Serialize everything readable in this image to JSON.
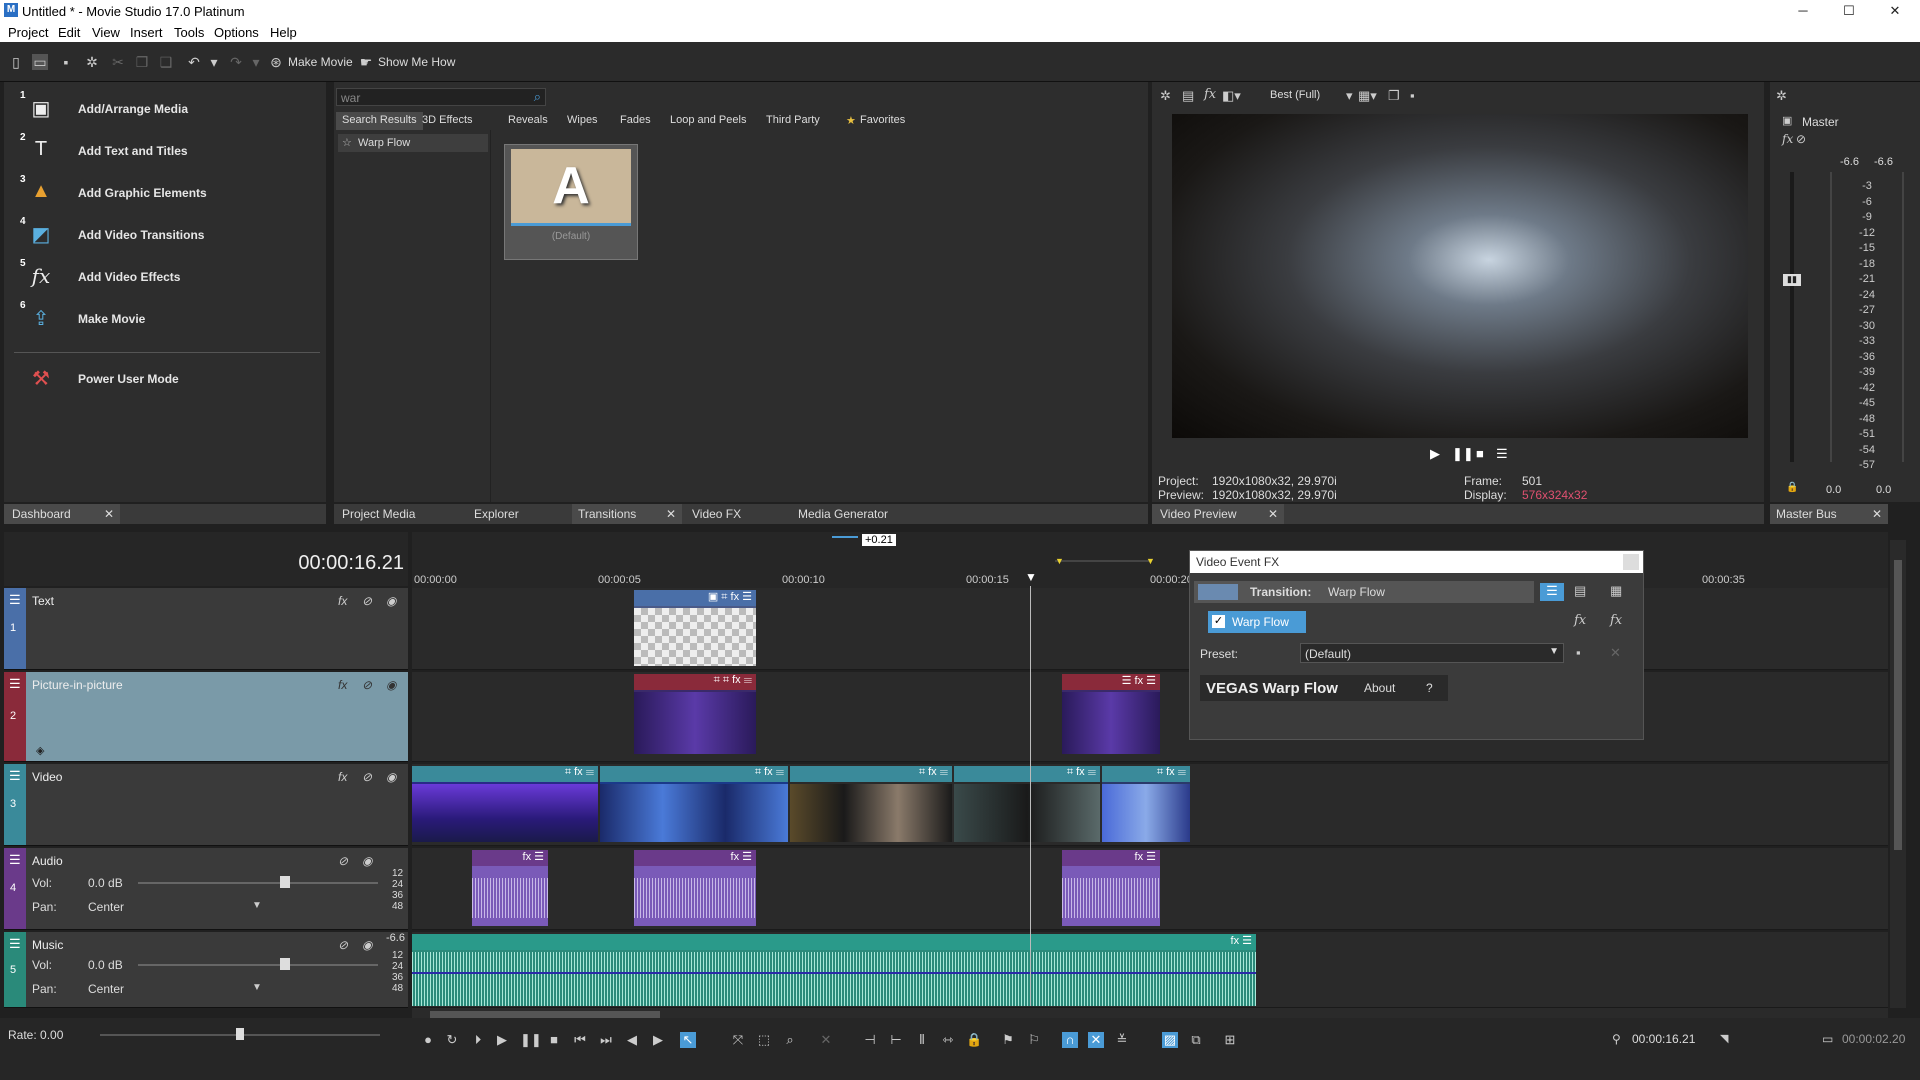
{
  "window": {
    "title": "Untitled * - Movie Studio 17.0 Platinum",
    "app_icon": "M",
    "minimize": "─",
    "maximize": "☐",
    "close": "✕"
  },
  "menu": [
    "Project",
    "Edit",
    "View",
    "Insert",
    "Tools",
    "Options",
    "Help"
  ],
  "toolbar": {
    "make_movie": "Make Movie",
    "show_me_how": "Show Me How"
  },
  "dashboard": {
    "tab": "Dashboard",
    "items": [
      {
        "num": "1",
        "label": "Add/Arrange Media",
        "icon": "media-icon"
      },
      {
        "num": "2",
        "label": "Add Text and Titles",
        "icon": "text-icon"
      },
      {
        "num": "3",
        "label": "Add Graphic Elements",
        "icon": "shapes-icon"
      },
      {
        "num": "4",
        "label": "Add Video Transitions",
        "icon": "transition-icon"
      },
      {
        "num": "5",
        "label": "Add Video Effects",
        "icon": "fx-icon"
      },
      {
        "num": "6",
        "label": "Make Movie",
        "icon": "export-icon"
      }
    ],
    "power_user": "Power User Mode"
  },
  "transitions": {
    "search_value": "war",
    "tabs": [
      "Search Results",
      "3D Effects",
      "Reveals",
      "Wipes",
      "Fades",
      "Loop and Peels",
      "Third Party",
      "Favorites"
    ],
    "list_item": "Warp Flow",
    "thumb_letter": "A",
    "thumb_label": "(Default)"
  },
  "bottom_tabs": [
    "Project Media",
    "Explorer",
    "Transitions",
    "Video FX",
    "Media Generator"
  ],
  "preview": {
    "quality": "Best (Full)",
    "project_label": "Project:",
    "project": "1920x1080x32, 29.970i",
    "preview_label": "Preview:",
    "preview": "1920x1080x32, 29.970i",
    "frame_label": "Frame:",
    "frame": "501",
    "display_label": "Display:",
    "display": "576x324x32",
    "tab": "Video Preview"
  },
  "master": {
    "title": "Master",
    "left_db": "-6.6",
    "right_db": "-6.6",
    "scale": [
      "3",
      "6",
      "9",
      "12",
      "15",
      "18",
      "21",
      "24",
      "27",
      "30",
      "33",
      "36",
      "39",
      "42",
      "45",
      "48",
      "51",
      "54",
      "57"
    ],
    "bottom_left": "0.0",
    "bottom_right": "0.0",
    "tab": "Master Bus"
  },
  "timeline": {
    "timecode": "00:00:16.21",
    "offset": "+0.21",
    "ruler": [
      "00:00:00",
      "00:00:05",
      "00:00:10",
      "00:00:15",
      "00:00:20",
      "00:00:35"
    ],
    "tracks": [
      {
        "num": "1",
        "name": "Text",
        "color": "#4a6fa8"
      },
      {
        "num": "2",
        "name": "Picture-in-picture",
        "color": "#8a2a3a"
      },
      {
        "num": "3",
        "name": "Video",
        "color": "#3a8a9a"
      },
      {
        "num": "4",
        "name": "Audio",
        "color": "#6a3a8a",
        "vol_label": "Vol:",
        "vol": "0.0 dB",
        "pan_label": "Pan:",
        "pan": "Center"
      },
      {
        "num": "5",
        "name": "Music",
        "color": "#2a8a7a",
        "vol_label": "Vol:",
        "vol": "0.0 dB",
        "pan_label": "Pan:",
        "pan": "Center"
      }
    ],
    "meter_scale": [
      "12",
      "24",
      "36",
      "48"
    ],
    "music_db": "-6.6",
    "rate": "Rate: 0.00"
  },
  "vfx": {
    "title": "Video Event FX",
    "transition_label": "Transition:",
    "transition_name": "Warp Flow",
    "chain_item": "Warp Flow",
    "preset_label": "Preset:",
    "preset": "(Default)",
    "plugin_name": "VEGAS Warp Flow",
    "about": "About",
    "help": "?"
  },
  "status": {
    "cursor_time": "00:00:16.21",
    "length": "00:00:02.20"
  }
}
